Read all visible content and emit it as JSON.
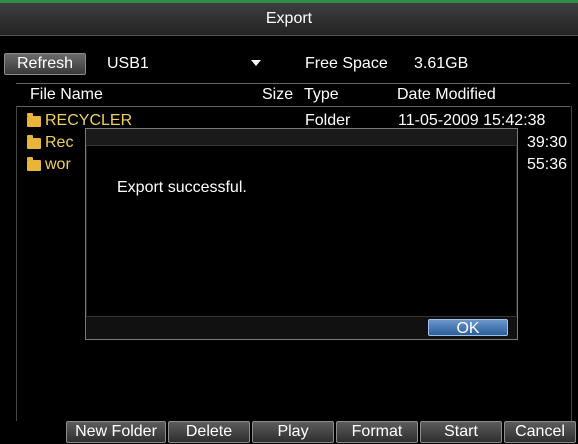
{
  "window": {
    "title": "Export"
  },
  "toolbar": {
    "refresh_label": "Refresh",
    "device_selected": "USB1",
    "free_space_label": "Free Space",
    "free_space_value": "3.61GB"
  },
  "list": {
    "headers": {
      "name": "File Name",
      "size": "Size",
      "type": "Type",
      "date": "Date Modified"
    },
    "rows": [
      {
        "name": "RECYCLER",
        "type": "Folder",
        "date": "11-05-2009 15:42:38"
      },
      {
        "name": "Rec",
        "type": "",
        "date": "39:30"
      },
      {
        "name": "wor",
        "type": "",
        "date": "55:36"
      }
    ]
  },
  "dialog": {
    "message": "Export successful.",
    "ok_label": "OK"
  },
  "actions": {
    "new_folder": "New Folder",
    "delete": "Delete",
    "play": "Play",
    "format": "Format",
    "start": "Start",
    "cancel": "Cancel"
  },
  "colors": {
    "accent_top": "#2f8f4a",
    "folder_icon": "#e8b43a",
    "file_name_text": "#f0d060",
    "ok_button": "#2c5e9c"
  }
}
